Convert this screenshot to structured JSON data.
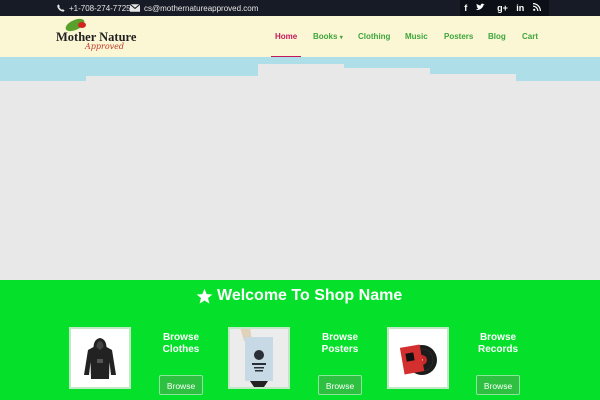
{
  "topbar": {
    "phone": "+1-708-274-7725",
    "email": "cs@mothernatureapproved.com",
    "social": [
      "facebook-icon",
      "twitter-icon",
      "google-plus-icon",
      "linkedin-icon",
      "rss-icon"
    ]
  },
  "logo": {
    "line1": "Mother Nature",
    "line2": "Approved"
  },
  "nav": [
    {
      "label": "Home"
    },
    {
      "label": "Books"
    },
    {
      "label": "Clothing"
    },
    {
      "label": "Music"
    },
    {
      "label": "Posters"
    },
    {
      "label": "Blog"
    },
    {
      "label": "Cart"
    }
  ],
  "colors": {
    "topbar": "#171b25",
    "header": "#fbf6d3",
    "nav_link": "#3da63d",
    "nav_active": "#c2185b",
    "band": "#05e12b",
    "hero_sky": "#aedfe8",
    "hero_block": "#e8e8e8"
  },
  "welcome": {
    "title": "Welcome To Shop Name",
    "icon": "star-icon"
  },
  "browse": [
    {
      "title_line1": "Browse",
      "title_line2": "Clothes",
      "button": "Browse",
      "image": "hoodie"
    },
    {
      "title_line1": "Browse",
      "title_line2": "Posters",
      "button": "Browse",
      "image": "poster"
    },
    {
      "title_line1": "Browse",
      "title_line2": "Records",
      "button": "Browse",
      "image": "vinyl-record"
    }
  ]
}
